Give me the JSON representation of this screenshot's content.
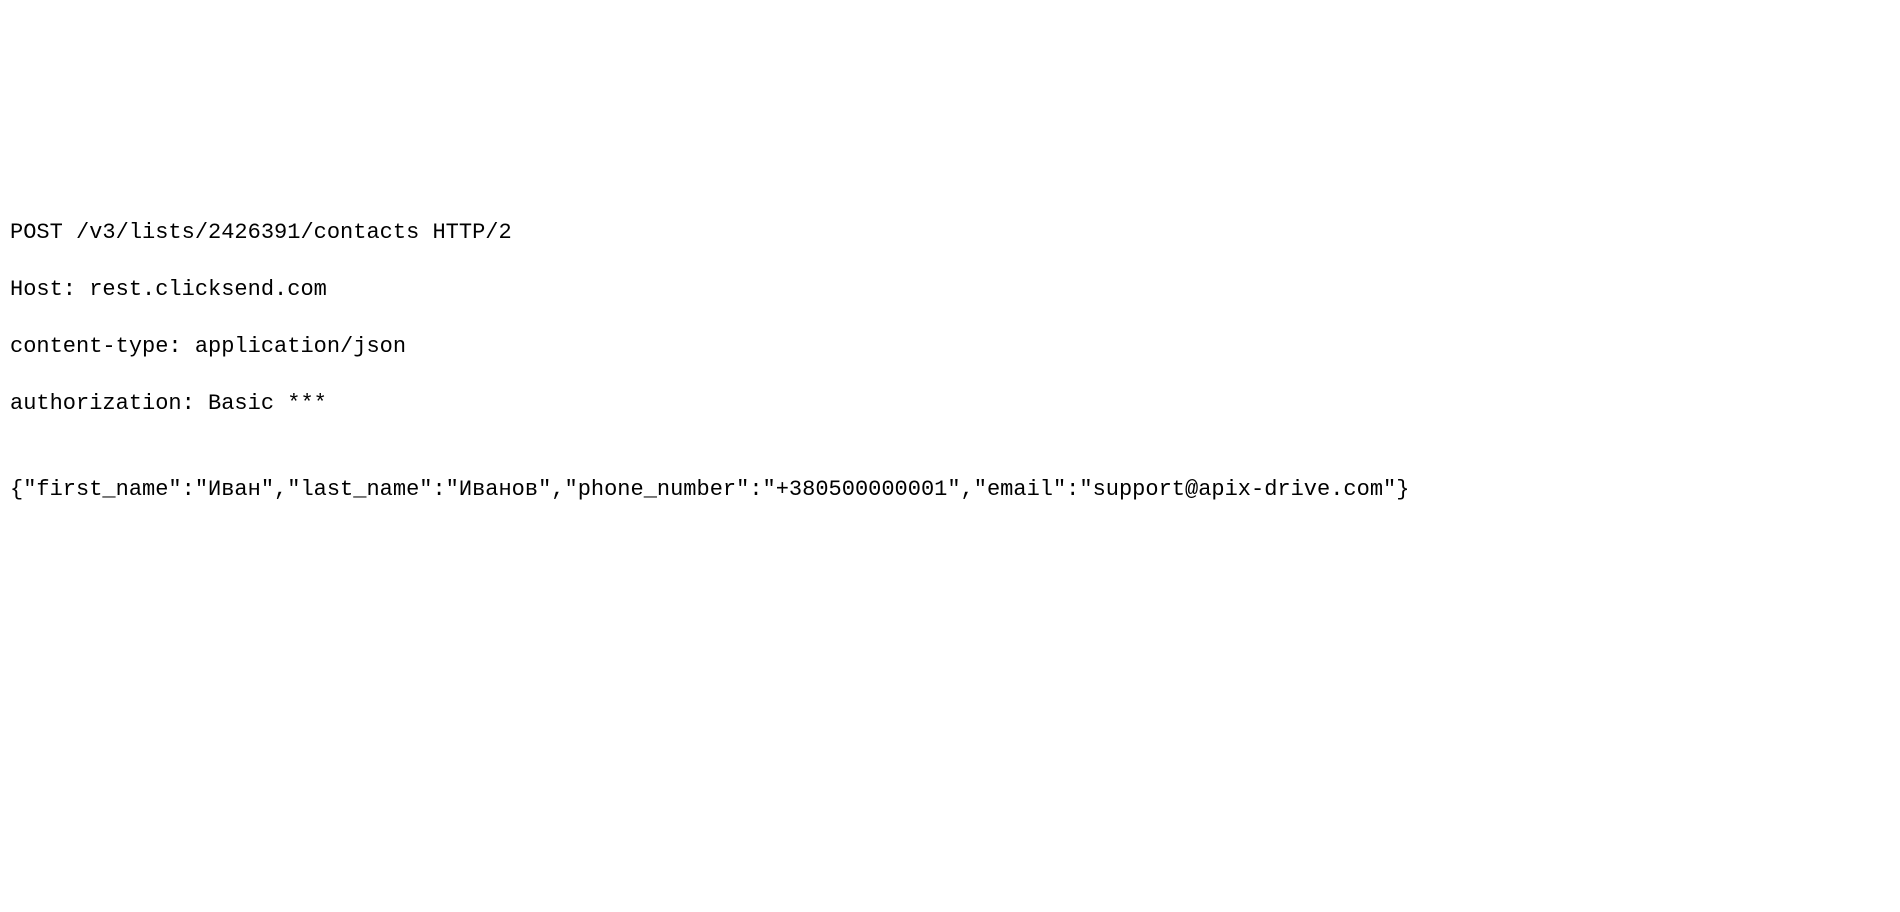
{
  "request": {
    "line1": "POST /v3/lists/2426391/contacts HTTP/2",
    "line2": "Host: rest.clicksend.com",
    "line3": "content-type: application/json",
    "line4": "authorization: Basic ***",
    "body": "{\"first_name\":\"Иван\",\"last_name\":\"Иванов\",\"phone_number\":\"+380500000001\",\"email\":\"support@apix-drive.com\"}"
  }
}
